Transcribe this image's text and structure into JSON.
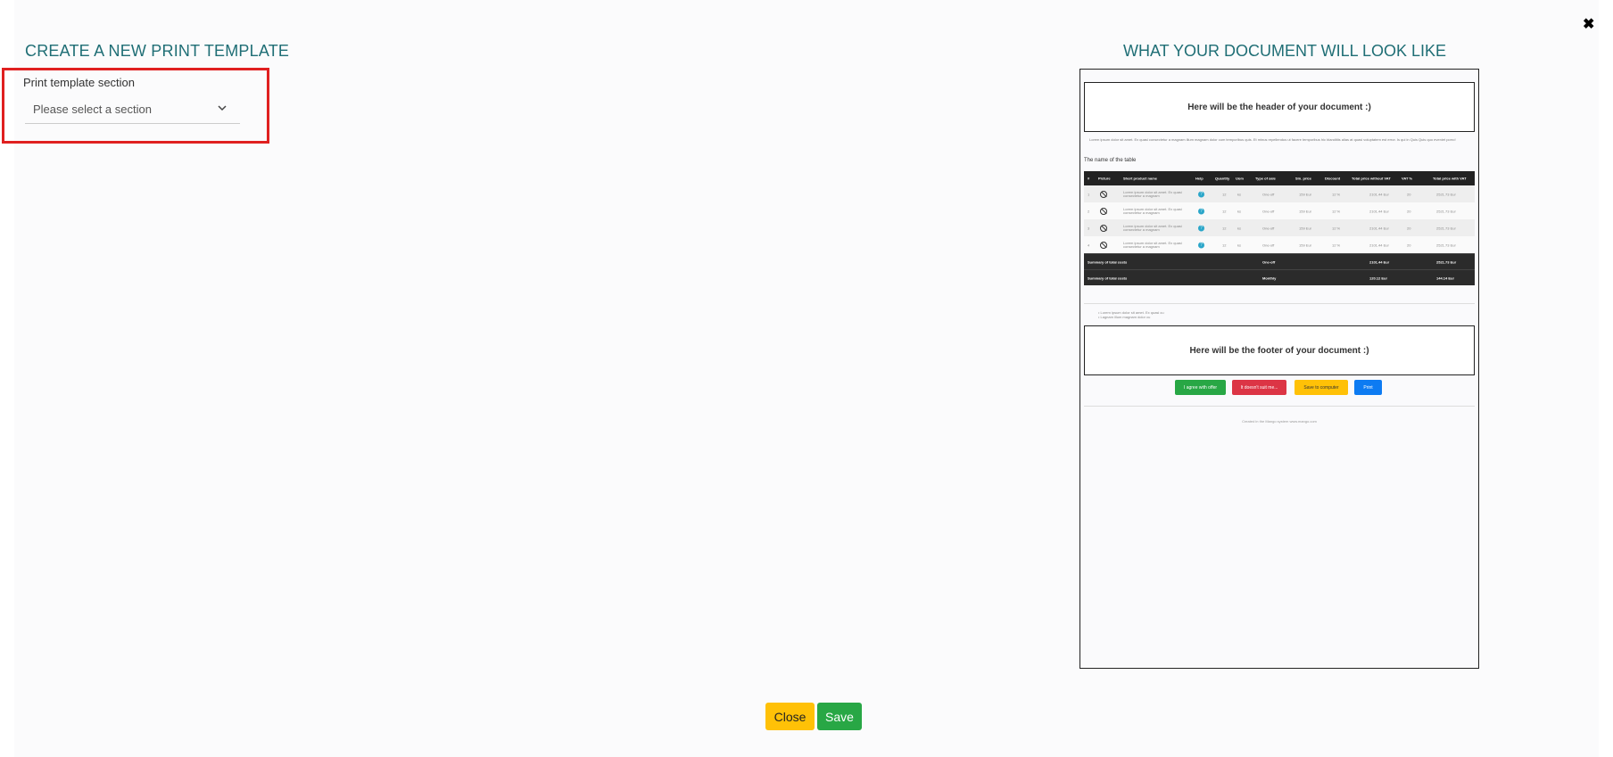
{
  "modal": {
    "close_glyph": "✖"
  },
  "left": {
    "title": "CREATE A NEW PRINT TEMPLATE",
    "section_label": "Print template section",
    "select_value": "Please select a section"
  },
  "right": {
    "title": "WHAT YOUR DOCUMENT WILL LOOK LIKE"
  },
  "preview": {
    "header_text": "Here will be the header of your document :)",
    "lorem": "Lorem ipsum dolor sit amet. Ex quasi consectetur a magnam illum magnam dolor cum temporibus quis. Et minus repellendus ut facere temporibus hic blanditiis alias at quasi voluptatem est error. Is qui in Quis Quis quo eveniet porro!",
    "table_name": "The name of the table",
    "columns": [
      "#",
      "Picture",
      "Short product name",
      "Help",
      "Quantity",
      "Uom",
      "Type of sale",
      "Sin. price",
      "Discount",
      "Total price without VAT",
      "VAT %",
      "Total price with VAT"
    ],
    "rows": [
      {
        "num": "1",
        "name": "Lorem ipsum dolor sit amet. Ex quasi consectetur a magnam",
        "qty": "12",
        "uom": "ks",
        "type": "One-off",
        "price": "159 Eur",
        "discount": "12 %",
        "total": "2101.44 Eur",
        "vat": "20",
        "total_vat": "2521.73 Eur"
      },
      {
        "num": "2",
        "name": "Lorem ipsum dolor sit amet. Ex quasi consectetur a magnam",
        "qty": "12",
        "uom": "ks",
        "type": "One-off",
        "price": "159 Eur",
        "discount": "12 %",
        "total": "2101.44 Eur",
        "vat": "20",
        "total_vat": "2521.73 Eur"
      },
      {
        "num": "3",
        "name": "Lorem ipsum dolor sit amet. Ex quasi consectetur a magnam",
        "qty": "12",
        "uom": "ks",
        "type": "One-off",
        "price": "159 Eur",
        "discount": "12 %",
        "total": "2101.44 Eur",
        "vat": "20",
        "total_vat": "2521.73 Eur"
      },
      {
        "num": "4",
        "name": "Lorem ipsum dolor sit amet. Ex quasi consectetur a magnam",
        "qty": "12",
        "uom": "ks",
        "type": "One-off",
        "price": "159 Eur",
        "discount": "12 %",
        "total": "2101.44 Eur",
        "vat": "20",
        "total_vat": "2521.73 Eur"
      }
    ],
    "summary": [
      {
        "label": "Summary of total costs",
        "type": "One-off",
        "total": "2101.44 Eur",
        "total_vat": "2521.73 Eur"
      },
      {
        "label": "Summary of total costs",
        "type": "Monthly",
        "total": "120.12 Eur",
        "total_vat": "144.14 Eur"
      }
    ],
    "list_items": [
      "Lorem ipsum dolor sit amet. Ex quasi cu",
      "Lagnam illum magnam dolor cu"
    ],
    "footer_text": "Here will be the footer of your document :)",
    "buttons": [
      {
        "label": "I agree with offer",
        "color": "#28a745"
      },
      {
        "label": "It doesn't suit me...",
        "color": "#dc3545"
      },
      {
        "label": "Save to computer",
        "color": "#ffc107"
      },
      {
        "label": "Print",
        "color": "#0d7bf2"
      }
    ],
    "created": "Created in the Mango system www.mango.com"
  },
  "actions": {
    "close_label": "Close",
    "save_label": "Save"
  },
  "colors": {
    "title": "#1f6e75",
    "highlight_border": "#e02020",
    "close_button": "#ffc107",
    "save_button": "#28a745"
  }
}
